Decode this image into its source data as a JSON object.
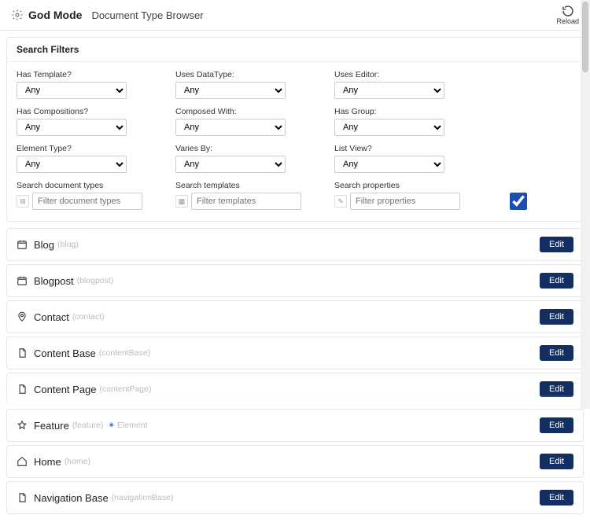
{
  "header": {
    "title": "God Mode",
    "subtitle": "Document Type Browser",
    "reload": "Reload"
  },
  "filters": {
    "heading": "Search Filters",
    "col1": {
      "hasTemplate": {
        "label": "Has Template?",
        "value": "Any"
      },
      "hasCompositions": {
        "label": "Has Compositions?",
        "value": "Any"
      },
      "elementType": {
        "label": "Element Type?",
        "value": "Any"
      },
      "searchDocTypes": {
        "label": "Search document types",
        "placeholder": "Filter document types"
      }
    },
    "col2": {
      "usesDataType": {
        "label": "Uses DataType:",
        "value": "Any"
      },
      "composedWith": {
        "label": "Composed With:",
        "value": "Any"
      },
      "variesBy": {
        "label": "Varies By:",
        "value": "Any"
      },
      "searchTemplates": {
        "label": "Search templates",
        "placeholder": "Filter templates"
      }
    },
    "col3": {
      "usesEditor": {
        "label": "Uses Editor:",
        "value": "Any"
      },
      "hasGroup": {
        "label": "Has Group:",
        "value": "Any"
      },
      "listView": {
        "label": "List View?",
        "value": "Any"
      },
      "searchProps": {
        "label": "Search properties",
        "placeholder": "Filter properties",
        "checked": true
      }
    }
  },
  "editLabel": "Edit",
  "items": [
    {
      "name": "Blog",
      "alias": "(blog)",
      "icon": "calendar"
    },
    {
      "name": "Blogpost",
      "alias": "(blogpost)",
      "icon": "calendar"
    },
    {
      "name": "Contact",
      "alias": "(contact)",
      "icon": "pin"
    },
    {
      "name": "Content Base",
      "alias": "(contentBase)",
      "icon": "doc"
    },
    {
      "name": "Content Page",
      "alias": "(contentPage)",
      "icon": "doc"
    },
    {
      "name": "Feature",
      "alias": "(feature)",
      "icon": "star",
      "badge": "Element"
    },
    {
      "name": "Home",
      "alias": "(home)",
      "icon": "home"
    },
    {
      "name": "Navigation Base",
      "alias": "(navigationBase)",
      "icon": "doc"
    }
  ]
}
